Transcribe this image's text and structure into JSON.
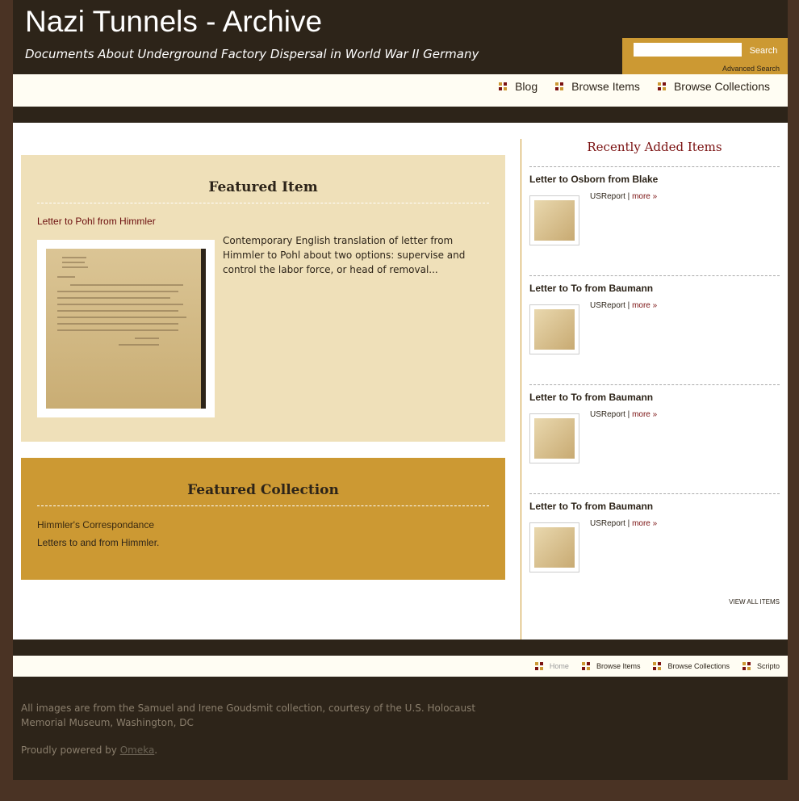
{
  "header": {
    "site_title": "Nazi Tunnels - Archive",
    "site_description": "Documents About Underground Factory Dispersal in World War II Germany",
    "search_button": "Search",
    "search_placeholder": "",
    "advanced_search": "Advanced Search"
  },
  "nav": {
    "items": [
      {
        "label": "Blog"
      },
      {
        "label": "Browse Items"
      },
      {
        "label": "Browse Collections"
      }
    ]
  },
  "featured_item": {
    "heading": "Featured Item",
    "title": "Letter to Pohl from Himmler",
    "description": "Contemporary English translation of letter from Himmler to Pohl about two options: supervise and control the labor force, or head of removal..."
  },
  "featured_collection": {
    "heading": "Featured Collection",
    "title": "Himmler's Correspondance",
    "description": "Letters to and from Himmler."
  },
  "recent": {
    "heading": "Recently Added Items",
    "items": [
      {
        "title": "Letter to Osborn from Blake",
        "type": "USReport",
        "sep": " | ",
        "more": "more »"
      },
      {
        "title": "Letter to To from Baumann",
        "type": "USReport",
        "sep": " | ",
        "more": "more »"
      },
      {
        "title": "Letter to To from Baumann",
        "type": "USReport",
        "sep": " | ",
        "more": "more »"
      },
      {
        "title": "Letter to To from Baumann",
        "type": "USReport",
        "sep": " | ",
        "more": "more »"
      }
    ],
    "view_all": "VIEW ALL ITEMS"
  },
  "footer_nav": {
    "items": [
      {
        "label": "Home"
      },
      {
        "label": "Browse Items"
      },
      {
        "label": "Browse Collections"
      },
      {
        "label": "Scripto"
      }
    ]
  },
  "footer": {
    "credit": "All images are from the Samuel and Irene Goudsmit collection, courtesy of the U.S. Holocaust Memorial Museum, Washington, DC",
    "powered_prefix": "Proudly powered by ",
    "powered_link": "Omeka",
    "powered_suffix": "."
  },
  "colors": {
    "dark_brown": "#2d2419",
    "outer_brown": "#4a3324",
    "gold": "#cc9933",
    "tan": "#efe0b9",
    "maroon": "#7a1010",
    "cream": "#fffdf3"
  }
}
